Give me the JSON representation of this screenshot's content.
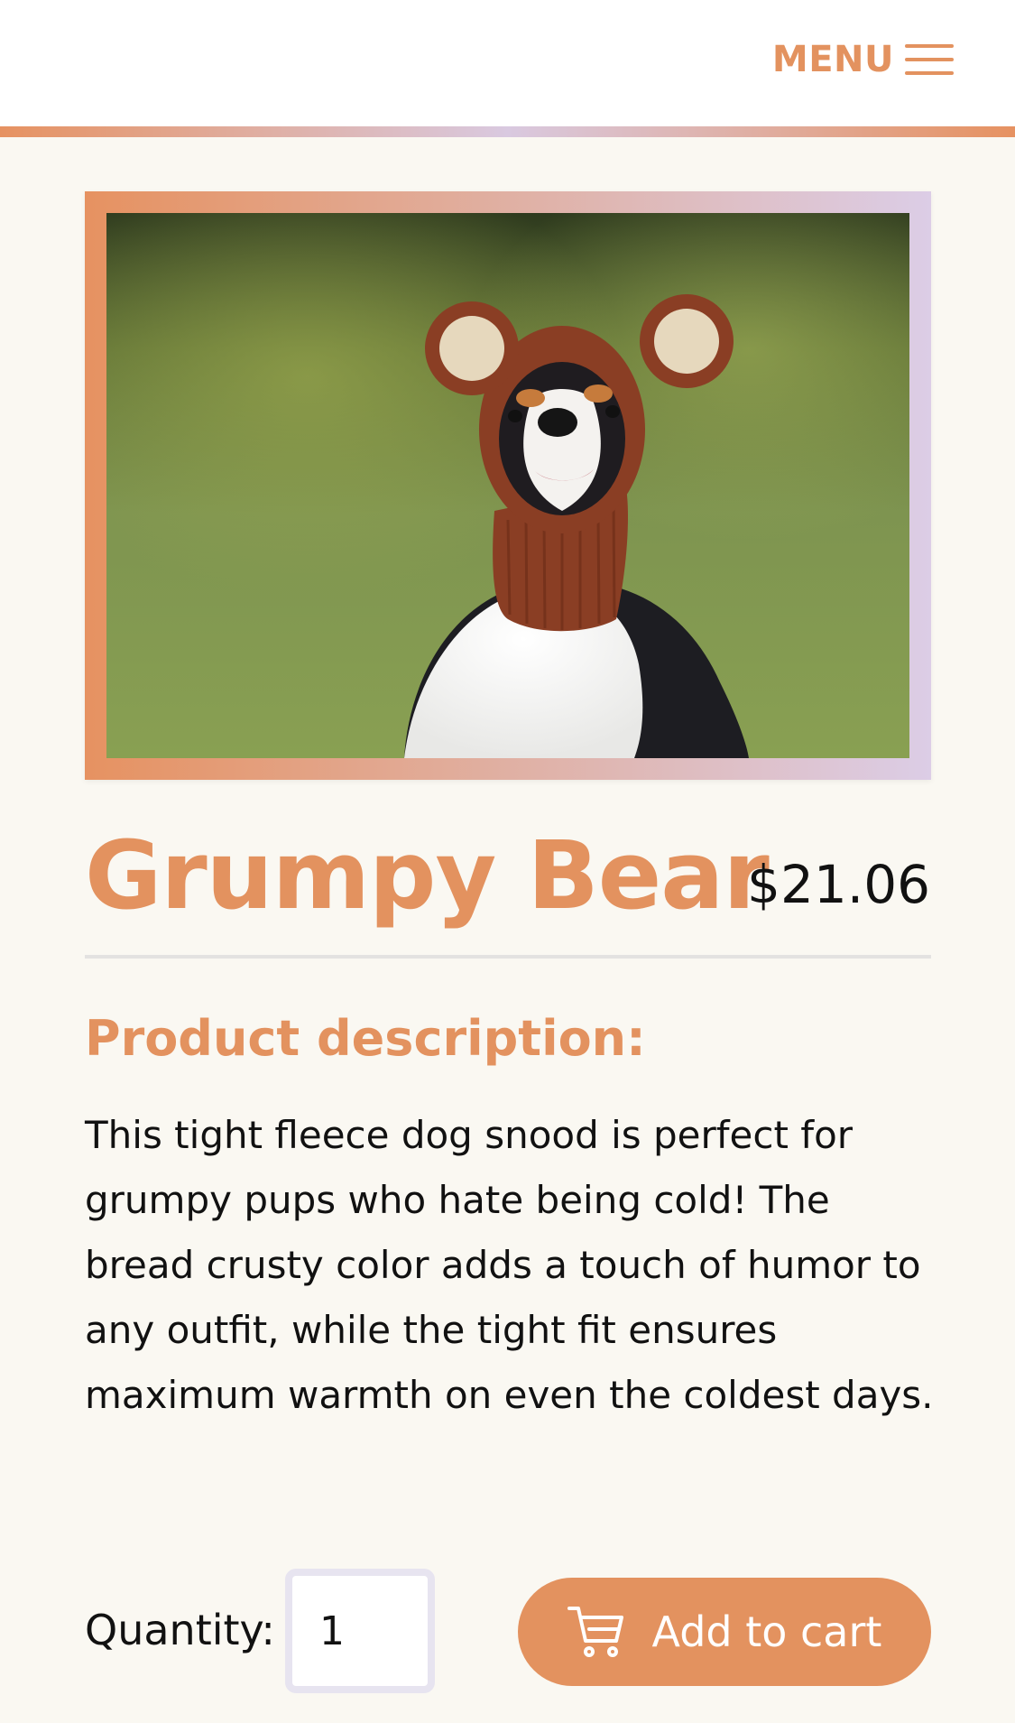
{
  "header": {
    "menu_label": "MENU",
    "menu_icon": "hamburger-icon",
    "accent_color": "#e3925f"
  },
  "product": {
    "image_icon": "product-photo",
    "title": "Grumpy Bear",
    "price": "$21.06",
    "description_heading": "Product description:",
    "description": "This tight fleece dog snood is perfect for grumpy pups who hate being cold! The bread crusty color adds a touch of humor to any outfit, while the tight fit ensures maximum warmth on even the coldest days."
  },
  "purchase": {
    "quantity_label": "Quantity:",
    "quantity_value": "1",
    "add_to_cart_label": "Add to cart",
    "cart_icon": "cart-icon"
  }
}
